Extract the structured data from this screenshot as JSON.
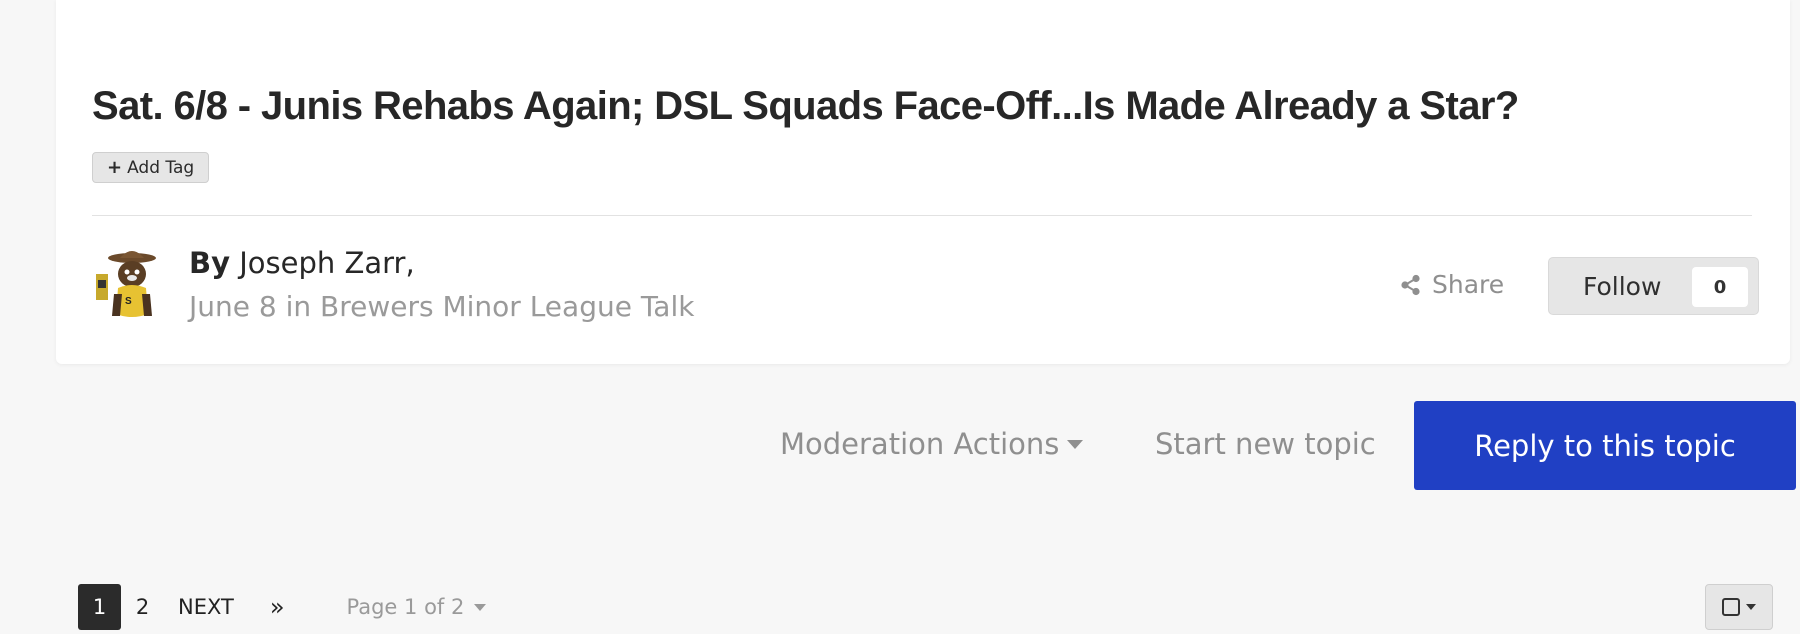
{
  "topic": {
    "title": "Sat. 6/8 - Junis Rehabs Again; DSL Squads Face-Off...Is Made Already a Star?",
    "add_tag_label": "Add Tag",
    "author_prefix": "By",
    "author_name": "Joseph Zarr,",
    "meta": "June 8 in Brewers Minor League Talk"
  },
  "actions": {
    "share_label": "Share",
    "follow_label": "Follow",
    "follow_count": "0",
    "moderation_label": "Moderation Actions",
    "start_topic_label": "Start new topic",
    "reply_label": "Reply to this topic"
  },
  "pagination": {
    "pages": [
      "1",
      "2"
    ],
    "current_page": "1",
    "next_label": "NEXT",
    "last_label": "»",
    "page_jump_label": "Page 1 of 2"
  },
  "colors": {
    "primary": "#2040c4",
    "title": "#272727",
    "muted": "#9a9a9a"
  },
  "icons": {
    "add_tag": "plus-icon",
    "share": "share-icon",
    "moderation": "caret-down-icon",
    "select": "checkbox-icon"
  }
}
